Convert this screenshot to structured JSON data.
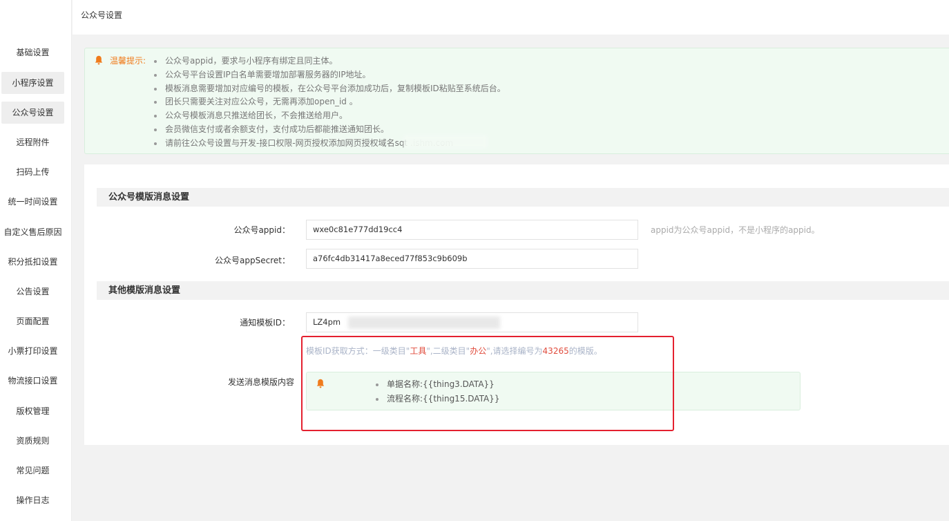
{
  "header": {
    "title": "公众号设置"
  },
  "sidebar": {
    "items": [
      {
        "label": "基础设置"
      },
      {
        "label": "小程序设置"
      },
      {
        "label": "公众号设置"
      },
      {
        "label": "远程附件"
      },
      {
        "label": "扫码上传"
      },
      {
        "label": "统一时间设置"
      },
      {
        "label": "自定义售后原因"
      },
      {
        "label": "积分抵扣设置"
      },
      {
        "label": "公告设置"
      },
      {
        "label": "页面配置"
      },
      {
        "label": "小票打印设置"
      },
      {
        "label": "物流接口设置"
      },
      {
        "label": "版权管理"
      },
      {
        "label": "资质规则"
      },
      {
        "label": "常见问题"
      },
      {
        "label": "操作日志"
      }
    ]
  },
  "tip": {
    "label": "温馨提示:",
    "items": [
      "公众号appid，要求与小程序有绑定且同主体。",
      "公众号平台设置IP白名单需要增加部署服务器的IP地址。",
      "模板消息需要增加对应编号的模板，在公众号平台添加成功后，复制模板ID粘贴至系统后台。",
      "团长只需要关注对应公众号，无需再添加open_id 。",
      "公众号模板消息只推送给团长，不会推送给用户。",
      "会员微信支付或者余额支付，支付成功后都能推送通知团长。",
      "请前往公众号设置与开发-接口权限-网页授权添加网页授权域名sqt         .ishm.com"
    ]
  },
  "section1": {
    "title": "公众号模版消息设置",
    "appid_label": "公众号appid：",
    "appid_value": "wxe0c81e777dd19cc4",
    "appid_hint": "appid为公众号appid，不是小程序的appid。",
    "secret_label": "公众号appSecret：",
    "secret_value": "a76fc4db31417a8eced77f853c9b609b"
  },
  "section2": {
    "title": "其他模版消息设置",
    "template_label": "通知模板ID：",
    "template_value": "LZ4pm",
    "howto_prefix": "模板ID获取方式：一级类目\"",
    "cat1": "工具",
    "howto_mid": "\",二级类目\"",
    "cat2": "办公",
    "howto_mid2": "\",请选择编号为",
    "template_no": "43265",
    "howto_suffix": "的模版。",
    "content_label": "发送消息模版内容",
    "content_items": [
      "单据名称:{{thing3.DATA}}",
      "流程名称:{{thing15.DATA}}"
    ]
  },
  "colors": {
    "accent": "#e04b3c",
    "tip_label": "#f07b1c",
    "highlight_frame": "#e4202f"
  },
  "icons": {
    "tip": "bell-icon"
  }
}
